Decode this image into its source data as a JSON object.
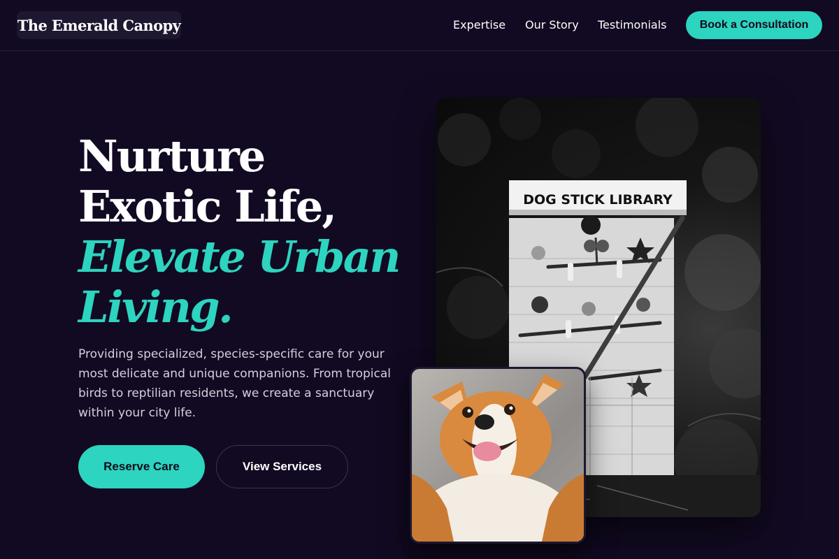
{
  "nav": {
    "logo": "The Emerald Canopy",
    "links": [
      "Expertise",
      "Our Story",
      "Testimonials"
    ],
    "cta": "Book a Consultation"
  },
  "hero": {
    "title_line1": "Nurture",
    "title_line2": "Exotic Life,",
    "accent_line1": "Elevate Urban",
    "accent_line2": "Living.",
    "description": "Providing specialized, species-specific care for your most delicate and unique companions. From tropical birds to reptilian residents, we create a sanctuary within your city life.",
    "primary_button": "Reserve Care",
    "secondary_button": "View Services"
  },
  "images": {
    "main_sign_text": "DOG STICK LIBRARY"
  },
  "colors": {
    "background": "#120a22",
    "accent": "#2dd4bf",
    "text_muted": "#d4d0de"
  }
}
